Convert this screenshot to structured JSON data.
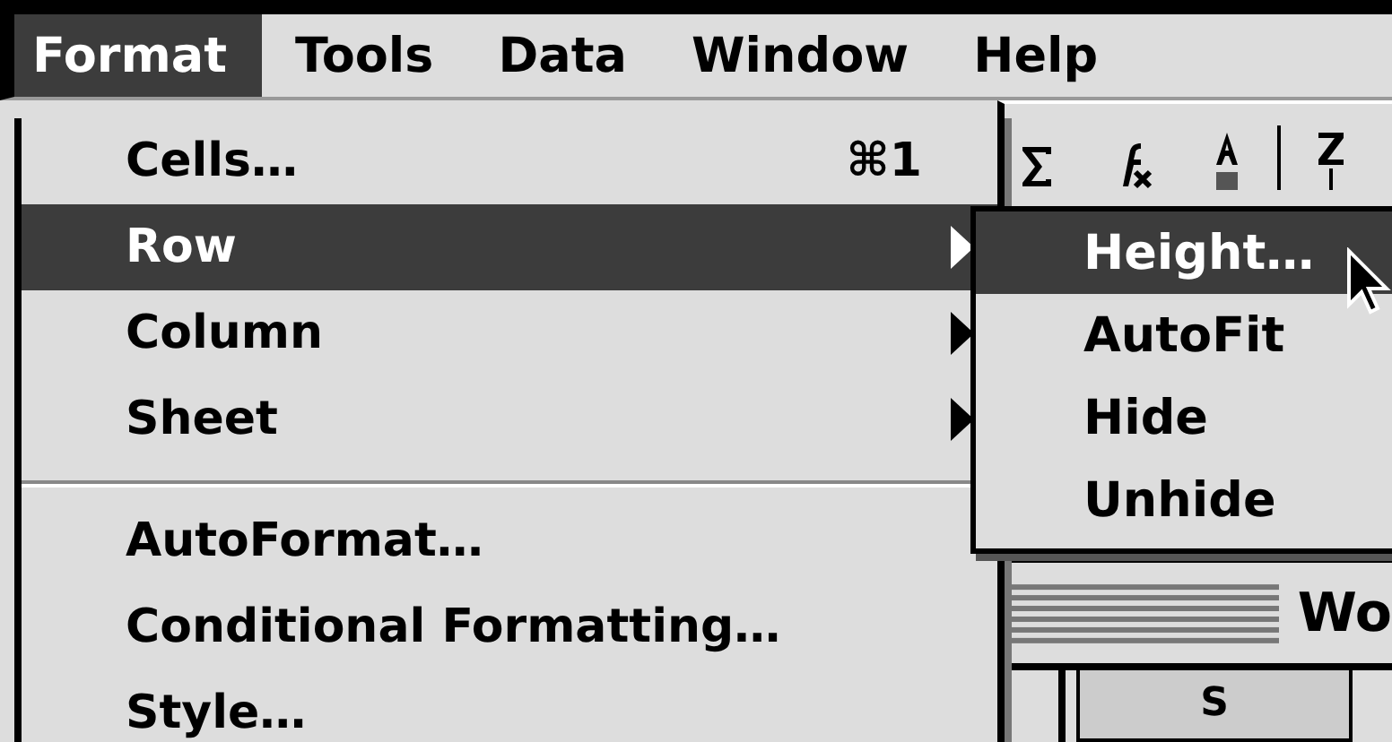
{
  "menu_bar": {
    "items": [
      {
        "label": "Format",
        "selected": true
      },
      {
        "label": "Tools",
        "selected": false
      },
      {
        "label": "Data",
        "selected": false
      },
      {
        "label": "Window",
        "selected": false
      },
      {
        "label": "Help",
        "selected": false
      }
    ]
  },
  "format_menu": {
    "items": [
      {
        "kind": "item",
        "label": "Cells…",
        "shortcut": "⌘1",
        "submenu": false,
        "selected": false
      },
      {
        "kind": "item",
        "label": "Row",
        "submenu": true,
        "selected": true
      },
      {
        "kind": "item",
        "label": "Column",
        "submenu": true,
        "selected": false
      },
      {
        "kind": "item",
        "label": "Sheet",
        "submenu": true,
        "selected": false
      },
      {
        "kind": "separator"
      },
      {
        "kind": "item",
        "label": "AutoFormat…",
        "submenu": false,
        "selected": false
      },
      {
        "kind": "item",
        "label": "Conditional Formatting…",
        "submenu": false,
        "selected": false
      },
      {
        "kind": "item",
        "label": "Style…",
        "submenu": false,
        "selected": false
      }
    ]
  },
  "row_submenu": {
    "items": [
      {
        "label": "Height…",
        "selected": true
      },
      {
        "label": "AutoFit",
        "selected": false
      },
      {
        "label": "Hide",
        "selected": false
      },
      {
        "label": "Unhide",
        "selected": false
      }
    ]
  },
  "workbook_window": {
    "title": "Wo",
    "column_header": "S"
  }
}
